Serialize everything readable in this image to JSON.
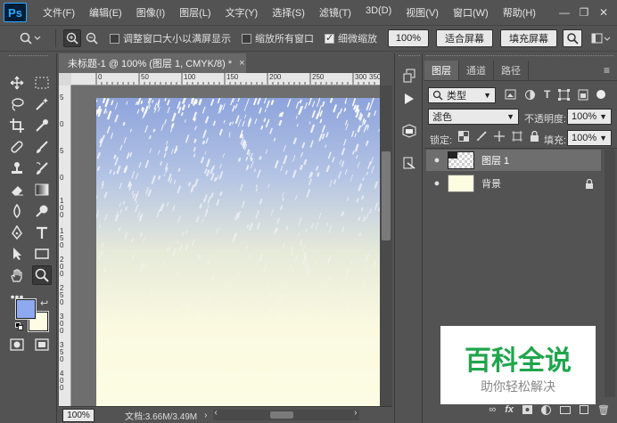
{
  "app": {
    "logo": "Ps"
  },
  "menu": [
    "文件(F)",
    "编辑(E)",
    "图像(I)",
    "图层(L)",
    "文字(Y)",
    "选择(S)",
    "滤镜(T)",
    "3D(D)",
    "视图(V)",
    "窗口(W)",
    "帮助(H)"
  ],
  "window_controls": {
    "minimize": "—",
    "restore": "❐",
    "close": "✕"
  },
  "options": {
    "resize_window_label": "调整窗口大小以满屏显示",
    "resize_window_checked": false,
    "zoom_all_label": "缩放所有窗口",
    "zoom_all_checked": false,
    "scrubby_zoom_label": "细微缩放",
    "scrubby_zoom_checked": true,
    "zoom_value": "100%",
    "fit_screen": "适合屏幕",
    "fill_screen": "填充屏幕"
  },
  "document": {
    "tab_title": "未标题-1 @ 100% (图层 1, CMYK/8) *",
    "tab_close": "×",
    "ruler_h": [
      "0",
      "50",
      "100",
      "150",
      "200",
      "250",
      "300",
      "350"
    ],
    "ruler_v": [
      "5",
      "0",
      "5",
      "0",
      "1\n0\n0",
      "1\n5\n0",
      "2\n0\n0",
      "2\n5\n0",
      "3\n0\n0",
      "3\n5\n0",
      "4\n0\n0"
    ],
    "zoom": "100%",
    "doc_size": "文档:3.66M/3.49M"
  },
  "colors": {
    "foreground": "#8fa9f0",
    "background": "#fdfbe3"
  },
  "layers_panel": {
    "tabs": [
      "图层",
      "通道",
      "路径"
    ],
    "active_tab": "图层",
    "filter_kind": "类型",
    "blend_mode": "滤色",
    "opacity_label": "不透明度:",
    "opacity": "100%",
    "lock_label": "锁定:",
    "fill_label": "填充:",
    "fill": "100%",
    "layers": [
      {
        "name": "图层 1",
        "selected": true,
        "visible": true,
        "locked": false
      },
      {
        "name": "背景",
        "selected": false,
        "visible": true,
        "locked": true
      }
    ]
  },
  "watermark": {
    "title": "百科全说",
    "subtitle": "助你轻松解决"
  }
}
